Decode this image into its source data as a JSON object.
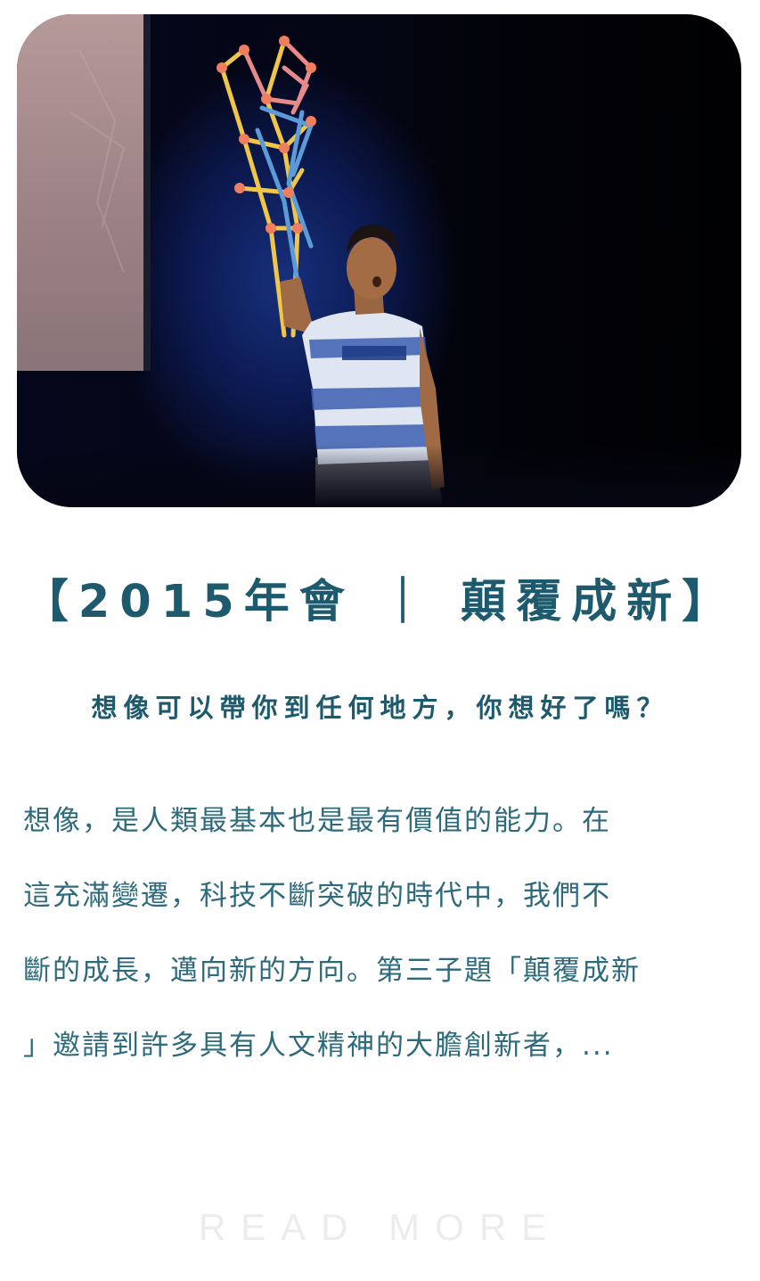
{
  "article": {
    "image_alt": "Speaker on stage holding a colorful straw sculpture",
    "title": "【2015年會 ｜ 顛覆成新】",
    "subtitle": "想像可以帶你到任何地方，你想好了嗎？",
    "body_lines": [
      "想像，是人類最基本也是最有價值的能力。在",
      "這充滿變遷，科技不斷突破的時代中，我們不",
      "斷的成長，邁向新的方向。第三子題「顛覆成新",
      "」邀請到許多具有人文精神的大膽創新者，..."
    ],
    "read_more_label": "READ MORE"
  },
  "colors": {
    "accent": "#1e5a6d",
    "body_text": "#2d6a7c",
    "read_more": "#ececec"
  }
}
